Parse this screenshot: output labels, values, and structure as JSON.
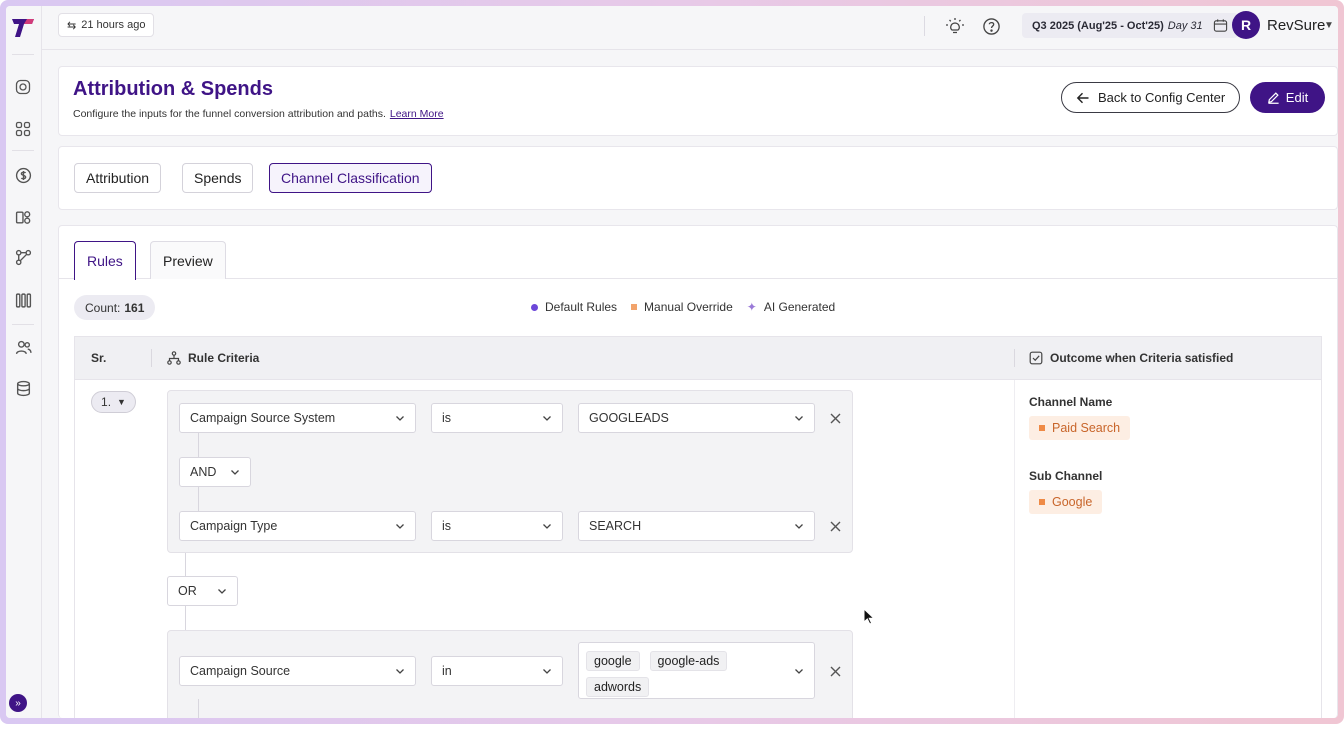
{
  "topbar": {
    "sync_label": "21 hours ago",
    "date_range": "Q3 2025 (Aug'25 - Oct'25)",
    "date_day": "Day 31",
    "avatar_initial": "R",
    "org_name": "RevSure"
  },
  "header": {
    "title": "Attribution & Spends",
    "subtitle": "Configure the inputs for the funnel conversion attribution and paths.",
    "learn_more": "Learn More",
    "back_label": "Back to Config Center",
    "edit_label": "Edit"
  },
  "main_tabs": [
    {
      "label": "Attribution",
      "active": false
    },
    {
      "label": "Spends",
      "active": false
    },
    {
      "label": "Channel Classification",
      "active": true
    }
  ],
  "sub_tabs": [
    {
      "label": "Rules",
      "active": true
    },
    {
      "label": "Preview",
      "active": false
    }
  ],
  "count": {
    "label": "Count:",
    "value": "161"
  },
  "legend": {
    "default": "Default Rules",
    "manual": "Manual Override",
    "ai": "AI Generated"
  },
  "table": {
    "col_sr": "Sr.",
    "col_criteria": "Rule Criteria",
    "col_outcome": "Outcome when Criteria satisfied"
  },
  "rule": {
    "sr": "1.",
    "group1": {
      "cond1": {
        "field": "Campaign Source System",
        "op": "is",
        "value": "GOOGLEADS"
      },
      "joiner": "AND",
      "cond2": {
        "field": "Campaign Type",
        "op": "is",
        "value": "SEARCH"
      }
    },
    "group_joiner": "OR",
    "group2": {
      "cond1": {
        "field": "Campaign Source",
        "op": "in",
        "values": [
          "google",
          "google-ads",
          "adwords"
        ]
      }
    },
    "outcome": {
      "channel_label": "Channel Name",
      "channel_value": "Paid Search",
      "subchannel_label": "Sub Channel",
      "subchannel_value": "Google"
    }
  },
  "colors": {
    "brand": "#3f1486",
    "default_dot": "#6c47d9",
    "manual_square": "#f2a36b",
    "outcome_bg": "#fdeee3",
    "outcome_text": "#c8652a"
  }
}
